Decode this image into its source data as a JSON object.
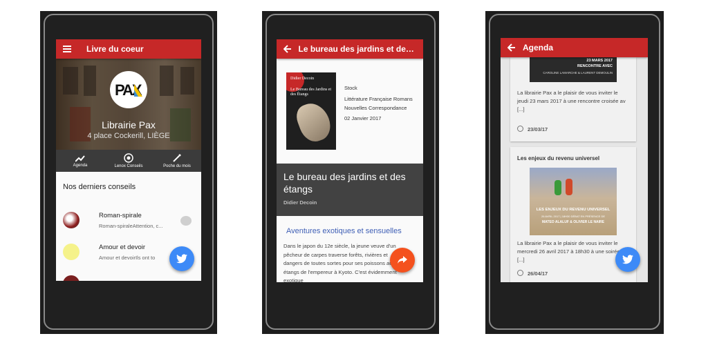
{
  "phone1": {
    "title": "Livre du coeur",
    "shop_name": "Librairie Pax",
    "shop_address": "4 place Cockerill, LIÈGE",
    "logo_text": "PAX",
    "tabs": [
      {
        "label": "Agenda",
        "icon": "trending-icon"
      },
      {
        "label": "Lenox Conseils",
        "icon": "aperture-icon"
      },
      {
        "label": "Poche du mois",
        "icon": "magic-wand-icon"
      }
    ],
    "section_title": "Nos derniers conseils",
    "items": [
      {
        "title": "Roman-spirale",
        "subtitle": "Roman-spiraleAttention, c..."
      },
      {
        "title": "Amour et devoir",
        "subtitle": "Amour et devoirIls ont to"
      }
    ]
  },
  "phone2": {
    "title": "Le bureau des jardins et des ...",
    "cover_author": "Didier Decoin",
    "cover_title": "Le Bureau des Jardins et des Étangs",
    "meta": [
      "Stock",
      "Littérature Française Romans",
      "Nouvelles Correspondance",
      "02 Janvier 2017"
    ],
    "book_title": "Le bureau des jardins et des étangs",
    "book_author": "Didier Decoin",
    "subheading": "Aventures exotiques et sensuelles",
    "paragraph": "Dans le japon du 12e siècle, la jeune veuve d'un pêcheur de carpes traverse forêts, rivières et dangers de toutes sortes pour ses poissons aux étangs de l'empereur à Kyoto. C'est évidemment exotique"
  },
  "phone3": {
    "title": "Agenda",
    "card1": {
      "image_caption_1": "23 MARS 2017",
      "image_caption_2": "RENCONTRE AVEC",
      "image_caption_3": "CAROLINE LAMARCHE & LAURENT DEMOULIN",
      "text": "La librairie Pax a le plaisir de vous inviter le jeudi 23 mars 2017 à une rencontre croisée av [...]",
      "date": "23/03/17"
    },
    "card2": {
      "title": "Les enjeux du revenu universel",
      "image_caption_1": "LES ENJEUX DU REVENU UNIVERSEL",
      "image_caption_2": "26 AVRIL 2017 | 18H30 DÉBAT EN PRÉSENCE DE",
      "image_caption_3": "MATEO ALALUF & OLIVIER LE NAIRE",
      "text": "La librairie Pax a le plaisir de vous inviter le mercredi 26 avril 2017 à 18h30 à une soirée d [...]",
      "date": "26/04/17"
    }
  },
  "colors": {
    "appbar": "#c62828",
    "fab_blue": "#3d8af7",
    "fab_orange": "#f4511e",
    "link": "#3f5fb5"
  }
}
